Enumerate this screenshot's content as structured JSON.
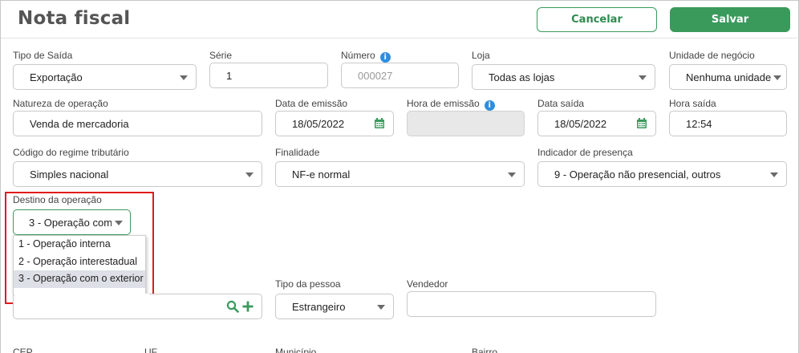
{
  "header": {
    "title": "Nota fiscal",
    "cancel_label": "Cancelar",
    "save_label": "Salvar"
  },
  "row1": {
    "tipo_saida": {
      "label": "Tipo de Saída",
      "value": "Exportação"
    },
    "serie": {
      "label": "Série",
      "value": "1"
    },
    "numero": {
      "label": "Número",
      "placeholder": "000027",
      "info": "i"
    },
    "loja": {
      "label": "Loja",
      "value": "Todas as lojas"
    },
    "unidade": {
      "label": "Unidade de negócio",
      "value": "Nenhuma unidade"
    }
  },
  "row2": {
    "natureza": {
      "label": "Natureza de operação",
      "value": "Venda de mercadoria"
    },
    "data_emissao": {
      "label": "Data de emissão",
      "value": "18/05/2022"
    },
    "hora_emissao": {
      "label": "Hora de emissão",
      "value": "",
      "info": "i"
    },
    "data_saida": {
      "label": "Data saída",
      "value": "18/05/2022"
    },
    "hora_saida": {
      "label": "Hora saída",
      "value": "12:54"
    }
  },
  "row3": {
    "regime": {
      "label": "Código do regime tributário",
      "value": "Simples nacional"
    },
    "finalidade": {
      "label": "Finalidade",
      "value": "NF-e normal"
    },
    "presenca": {
      "label": "Indicador de presença",
      "value": "9 - Operação não presencial, outros"
    }
  },
  "destino": {
    "label": "Destino da operação",
    "value": "3 - Operação com o exterior",
    "options": [
      "1 - Operação interna",
      "2 - Operação interestadual",
      "3 - Operação com o exterior"
    ],
    "selected_index": 2
  },
  "row5": {
    "tipo_pessoa": {
      "label": "Tipo da pessoa",
      "value": "Estrangeiro"
    },
    "vendedor": {
      "label": "Vendedor",
      "value": ""
    }
  },
  "partial_labels": [
    "CEP",
    "UF",
    "Município",
    "Bairro"
  ],
  "colors": {
    "accent": "#3a9a5c",
    "highlight_box": "#e01b1b",
    "info": "#2d8ee0"
  },
  "icons": [
    "chevron-down-icon",
    "calendar-icon",
    "info-icon",
    "search-icon",
    "plus-icon"
  ]
}
